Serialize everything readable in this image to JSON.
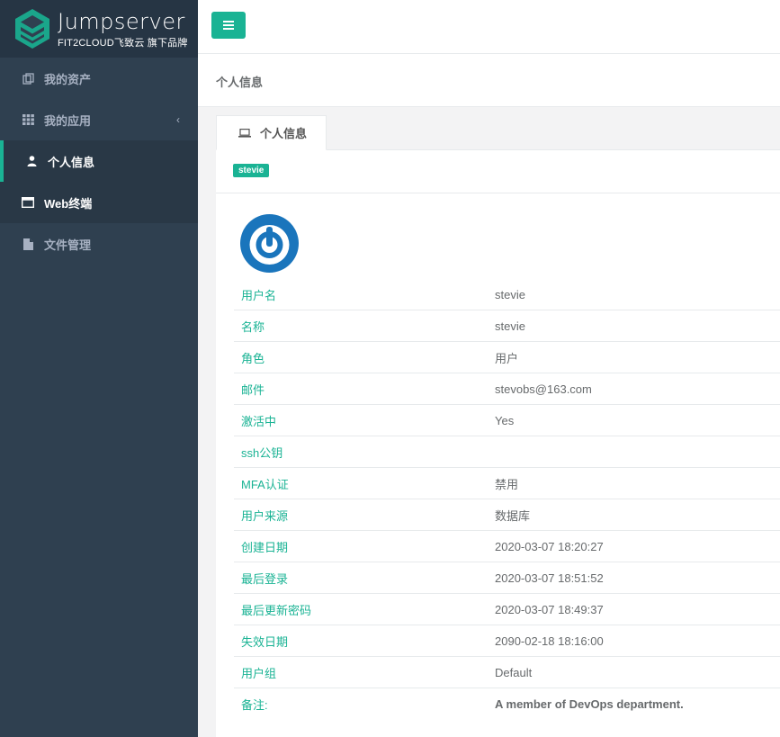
{
  "brand": {
    "name": "Jumpserver",
    "sub": "FIT2CLOUD飞致云 旗下品牌"
  },
  "sidebar": {
    "items": [
      {
        "label": "我的资产",
        "icon": "assets-icon"
      },
      {
        "label": "我的应用",
        "icon": "grid-icon"
      },
      {
        "label": "个人信息",
        "icon": "user-icon"
      },
      {
        "label": "Web终端",
        "icon": "window-icon"
      },
      {
        "label": "文件管理",
        "icon": "file-icon"
      }
    ]
  },
  "header": {
    "title": "个人信息"
  },
  "tabs": [
    {
      "label": "个人信息",
      "icon": "laptop-icon"
    }
  ],
  "user_badge": "stevie",
  "profile": {
    "rows": [
      {
        "key": "用户名",
        "value": "stevie"
      },
      {
        "key": "名称",
        "value": "stevie"
      },
      {
        "key": "角色",
        "value": "用户"
      },
      {
        "key": "邮件",
        "value": "stevobs@163.com"
      },
      {
        "key": "激活中",
        "value": "Yes"
      },
      {
        "key": "ssh公钥",
        "value": ""
      },
      {
        "key": "MFA认证",
        "value": "禁用"
      },
      {
        "key": "用户来源",
        "value": "数据库"
      },
      {
        "key": "创建日期",
        "value": "2020-03-07 18:20:27"
      },
      {
        "key": "最后登录",
        "value": "2020-03-07 18:51:52"
      },
      {
        "key": "最后更新密码",
        "value": "2020-03-07 18:49:37"
      },
      {
        "key": "失效日期",
        "value": "2090-02-18 18:16:00"
      },
      {
        "key": "用户组",
        "value": "Default"
      },
      {
        "key": "备注:",
        "value": "A member of DevOps department."
      }
    ]
  },
  "colors": {
    "accent": "#1ab394",
    "sidebar_bg": "#2f4050",
    "avatar_blue": "#1a75bc"
  }
}
